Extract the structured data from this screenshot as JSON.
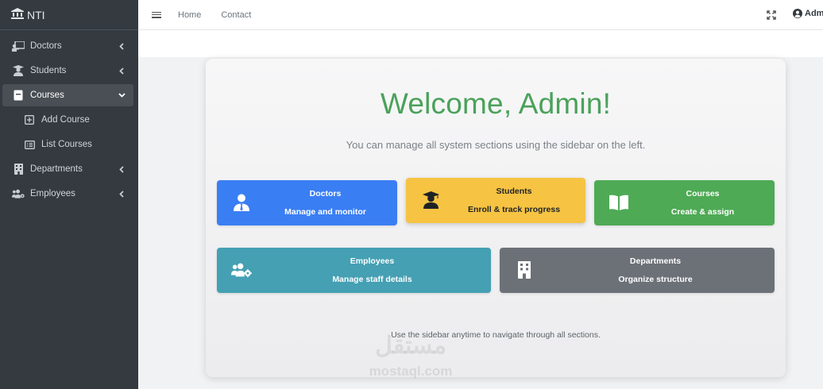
{
  "brand": {
    "name": "NTI",
    "icon": "bank-icon"
  },
  "sidebar": {
    "items": [
      {
        "label": "Doctors",
        "icon": "chalkboard-teacher-icon",
        "expandable": true,
        "expanded": false
      },
      {
        "label": "Students",
        "icon": "user-graduate-icon",
        "expandable": true,
        "expanded": false
      },
      {
        "label": "Courses",
        "icon": "book-icon",
        "expandable": true,
        "expanded": true,
        "active": true,
        "children": [
          {
            "label": "Add Course",
            "icon": "plus-square-icon"
          },
          {
            "label": "List Courses",
            "icon": "list-alt-icon"
          }
        ]
      },
      {
        "label": "Departments",
        "icon": "building-icon",
        "expandable": true,
        "expanded": false
      },
      {
        "label": "Employees",
        "icon": "users-cog-icon",
        "expandable": true,
        "expanded": false
      }
    ]
  },
  "topbar": {
    "menu_icon": "hamburger-icon",
    "links": [
      "Home",
      "Contact"
    ],
    "fullscreen_icon": "expand-icon",
    "user_label": "Adm",
    "user_icon": "user-circle-icon"
  },
  "main": {
    "title": "Welcome, Admin!",
    "subtitle": "You can manage all system sections using the sidebar on the left.",
    "tiles": [
      {
        "title": "Doctors",
        "description": "Manage and monitor",
        "icon": "user-tie-icon",
        "color": "#3a7ef4"
      },
      {
        "title": "Students",
        "description": "Enroll & track progress",
        "icon": "user-graduate-icon",
        "color": "#f6c343"
      },
      {
        "title": "Courses",
        "description": "Create & assign",
        "icon": "book-open-icon",
        "color": "#4eaa55"
      },
      {
        "title": "Employees",
        "description": "Manage staff details",
        "icon": "users-cog-icon",
        "color": "#45a0b3"
      },
      {
        "title": "Departments",
        "description": "Organize structure",
        "icon": "building-icon",
        "color": "#6c7178"
      }
    ],
    "footer_note": "Use the sidebar anytime to navigate through all sections."
  },
  "watermark": {
    "arabic": "مستقل",
    "latin": "mostaql.com"
  },
  "colors": {
    "sidebar_bg": "#343a40",
    "accent_green": "#4aa25a",
    "active_item_bg": "#494f55"
  }
}
